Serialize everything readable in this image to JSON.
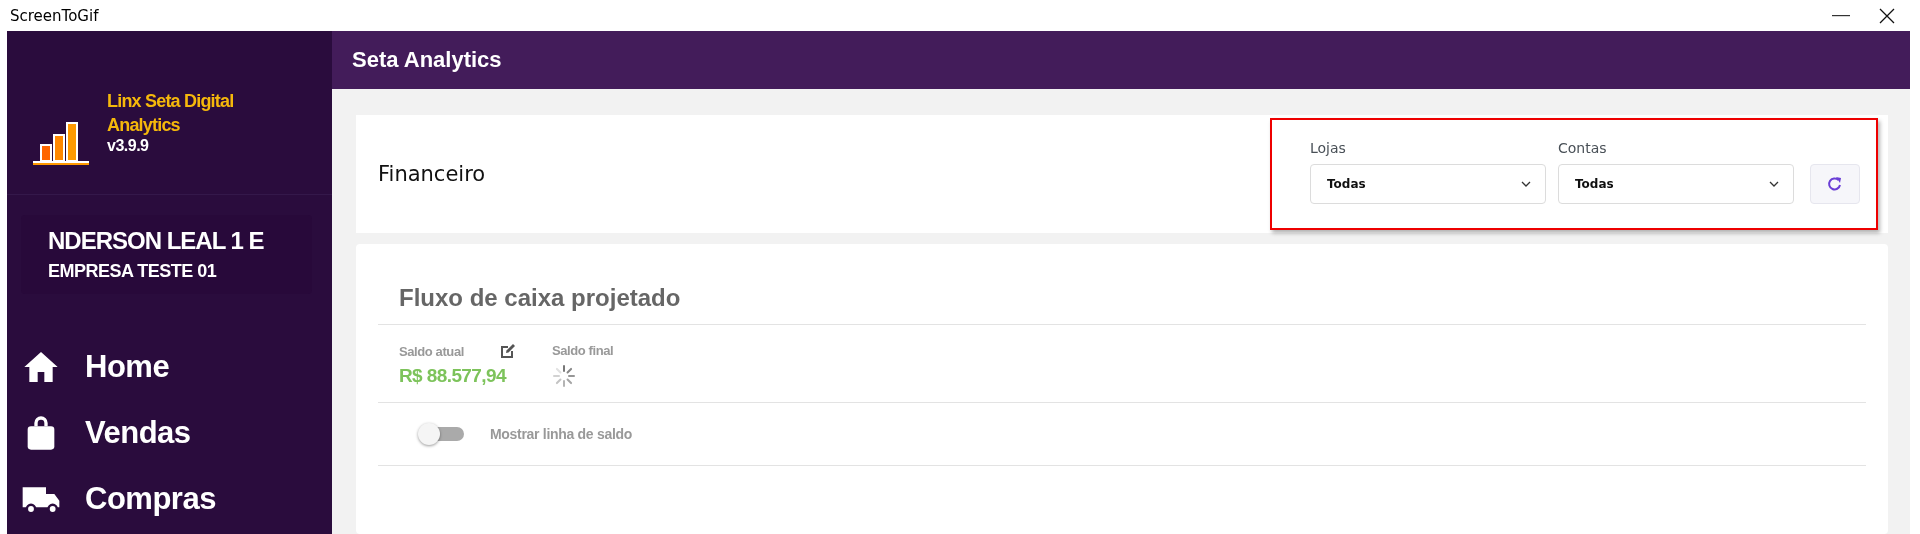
{
  "window": {
    "title": "ScreenToGif"
  },
  "sidebar": {
    "brand": {
      "name": "Linx Seta Digital Analytics",
      "version": "v3.9.9"
    },
    "user": {
      "name": "NDERSON LEAL 1 E",
      "company": "EMPRESA TESTE 01"
    },
    "items": [
      {
        "label": "Home",
        "kind": "home"
      },
      {
        "label": "Vendas",
        "kind": "bag"
      },
      {
        "label": "Compras",
        "kind": "truck"
      }
    ]
  },
  "header": {
    "title": "Seta Analytics"
  },
  "page": {
    "title": "Financeiro",
    "filters": [
      {
        "label": "Lojas",
        "value": "Todas"
      },
      {
        "label": "Contas",
        "value": "Todas"
      }
    ]
  },
  "cashflow": {
    "title": "Fluxo de caixa projetado",
    "current": {
      "label": "Saldo atual",
      "value": "R$ 88.577,94"
    },
    "final": {
      "label": "Saldo final",
      "loading": true
    },
    "toggle": {
      "label": "Mostrar linha de saldo",
      "on": false
    }
  }
}
